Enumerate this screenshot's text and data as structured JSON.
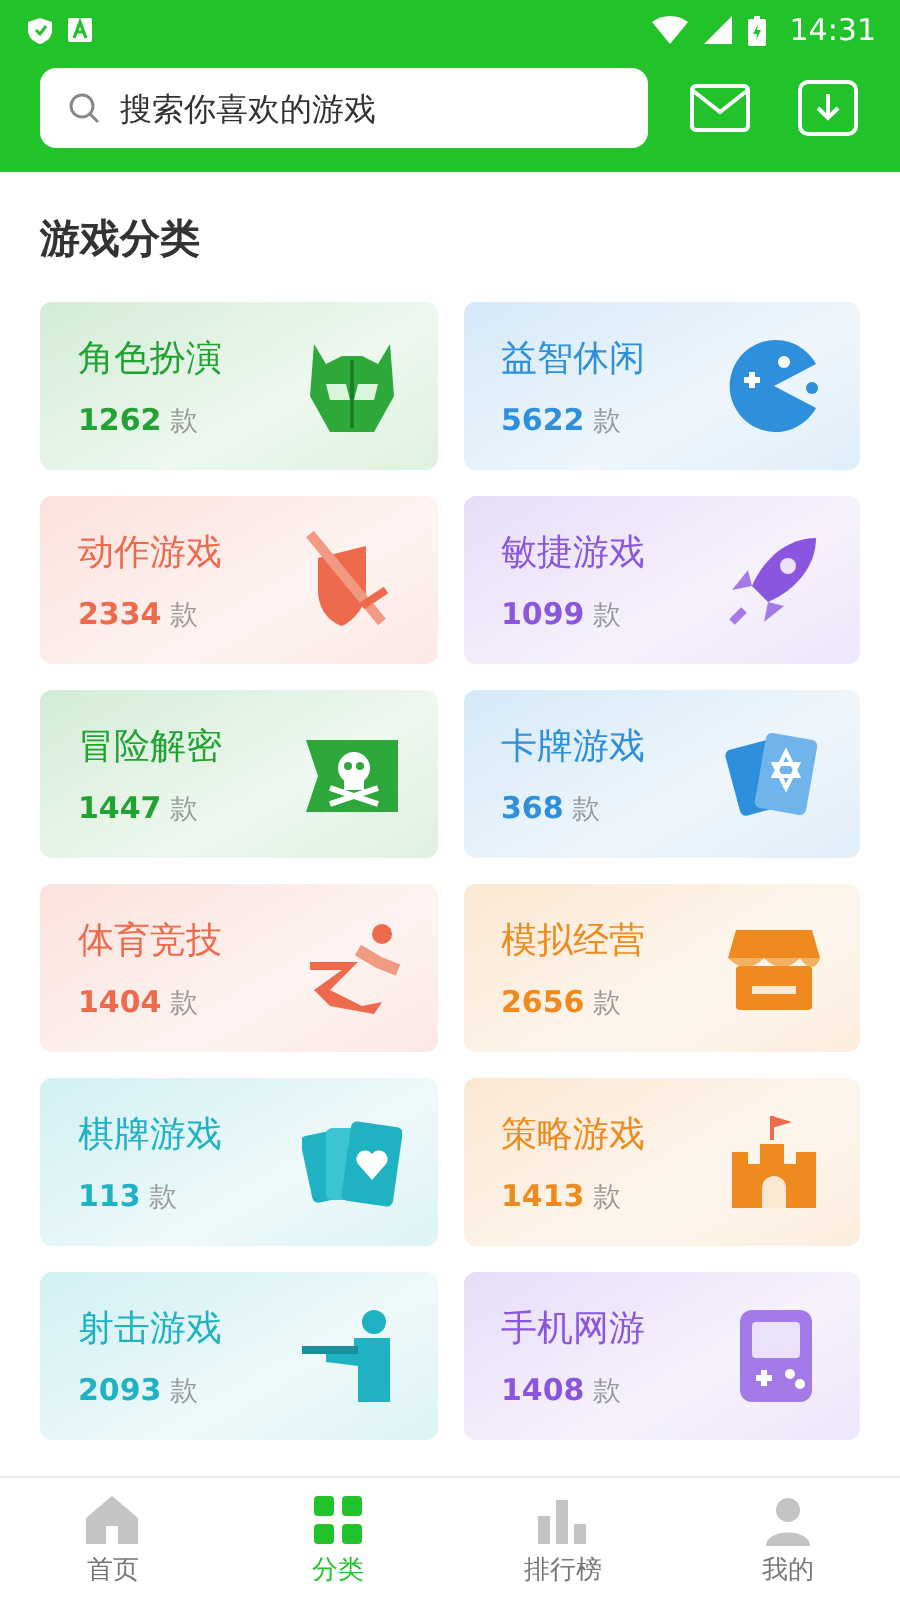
{
  "status_bar": {
    "time": "14:31"
  },
  "header": {
    "search": {
      "placeholder": "搜索你喜欢的游戏"
    }
  },
  "section_title": "游戏分类",
  "categories": [
    {
      "title": "角色扮演",
      "count": "1262",
      "unit": "款",
      "color": "#23a234"
    },
    {
      "title": "益智休闲",
      "count": "5622",
      "unit": "款",
      "color": "#2e8fdc"
    },
    {
      "title": "动作游戏",
      "count": "2334",
      "unit": "款",
      "color": "#ee6a4c"
    },
    {
      "title": "敏捷游戏",
      "count": "1099",
      "unit": "款",
      "color": "#8a56e0"
    },
    {
      "title": "冒险解密",
      "count": "1447",
      "unit": "款",
      "color": "#23a234"
    },
    {
      "title": "卡牌游戏",
      "count": "368",
      "unit": "款",
      "color": "#2e8fdc"
    },
    {
      "title": "体育竞技",
      "count": "1404",
      "unit": "款",
      "color": "#ee6a4c"
    },
    {
      "title": "模拟经营",
      "count": "2656",
      "unit": "款",
      "color": "#ee8a1e"
    },
    {
      "title": "棋牌游戏",
      "count": "113",
      "unit": "款",
      "color": "#1fb2c2"
    },
    {
      "title": "策略游戏",
      "count": "1413",
      "unit": "款",
      "color": "#ee8a1e"
    },
    {
      "title": "射击游戏",
      "count": "2093",
      "unit": "款",
      "color": "#1fb2c2"
    },
    {
      "title": "手机网游",
      "count": "1408",
      "unit": "款",
      "color": "#8a56e0"
    }
  ],
  "bottom_nav": [
    {
      "label": "首页",
      "selected": false
    },
    {
      "label": "分类",
      "selected": true
    },
    {
      "label": "排行榜",
      "selected": false
    },
    {
      "label": "我的",
      "selected": false
    }
  ]
}
